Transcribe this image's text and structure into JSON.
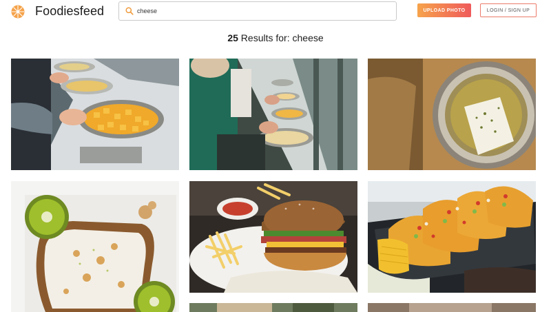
{
  "header": {
    "brand": "Foodiesfeed",
    "search": {
      "value": "cheese",
      "placeholder": ""
    },
    "upload_label": "UPLOAD PHOTO",
    "login_label": "LOGIN / SIGN UP"
  },
  "results": {
    "count": "25",
    "label": " Results for: cheese"
  },
  "colors": {
    "brand_orange": "#f6a34c",
    "brand_red": "#ef5a5a"
  },
  "icons": {
    "logo": "foodiesfeed-logo-icon",
    "search": "search-icon"
  }
}
